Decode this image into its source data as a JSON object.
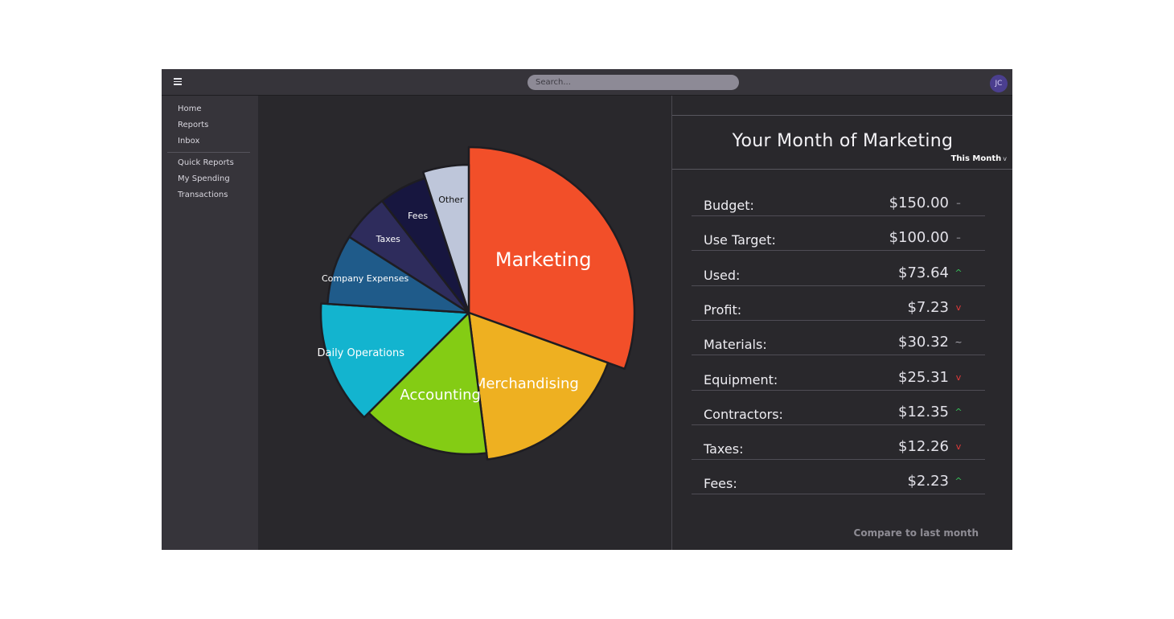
{
  "topbar": {
    "search_placeholder": "Search...",
    "avatar_initials": "JC"
  },
  "sidebar": {
    "items": [
      {
        "label": "Home"
      },
      {
        "label": "Reports"
      },
      {
        "label": "Inbox"
      },
      {
        "label": "Quick Reports"
      },
      {
        "label": "My Spending"
      },
      {
        "label": "Transactions"
      }
    ]
  },
  "chart_data": {
    "type": "pie",
    "categories": [
      "Marketing",
      "Merchandising",
      "Accounting",
      "Daily Operations",
      "Company Expenses",
      "Taxes",
      "Fees",
      "Other"
    ],
    "values": [
      30.5,
      17.5,
      14.5,
      13.5,
      8,
      5.5,
      5.5,
      5
    ],
    "colors": [
      "#f24f29",
      "#eeb021",
      "#84cc14",
      "#13b4cf",
      "#1f5b8a",
      "#2e2c5c",
      "#17163f",
      "#bec6da"
    ],
    "label_sizes": [
      "large",
      "medium",
      "medium",
      "small",
      "xsmall",
      "xsmall",
      "xsmall",
      "xsmall"
    ],
    "label_colors": [
      "#ffffff",
      "#ffffff",
      "#ffffff",
      "#ffffff",
      "#ffffff",
      "#ffffff",
      "#ffffff",
      "#111111"
    ],
    "exploded_radius_offsets": [
      22,
      0,
      -8,
      0,
      -8,
      -8,
      -8,
      0
    ]
  },
  "panel": {
    "title": "Your Month of Marketing",
    "period": "This Month",
    "period_chevron": "v",
    "stats": [
      {
        "label": "Budget:",
        "value": "$150.00",
        "trend": "–",
        "trend_color": "#b9b7c0"
      },
      {
        "label": "Use Target:",
        "value": "$100.00",
        "trend": "–",
        "trend_color": "#b9b7c0"
      },
      {
        "label": "Used:",
        "value": "$73.64",
        "trend": "^",
        "trend_color": "#37c25a"
      },
      {
        "label": "Profit:",
        "value": "$7.23",
        "trend": "v",
        "trend_color": "#e23a3a"
      },
      {
        "label": "Materials:",
        "value": "$30.32",
        "trend": "~",
        "trend_color": "#b9b7c0"
      },
      {
        "label": "Equipment:",
        "value": "$25.31",
        "trend": "v",
        "trend_color": "#e23a3a"
      },
      {
        "label": "Contractors:",
        "value": "$12.35",
        "trend": "^",
        "trend_color": "#37c25a"
      },
      {
        "label": "Taxes:",
        "value": "$12.26",
        "trend": "v",
        "trend_color": "#e23a3a"
      },
      {
        "label": "Fees:",
        "value": "$2.23",
        "trend": "^",
        "trend_color": "#37c25a"
      }
    ],
    "compare_label": "Compare to last month"
  }
}
